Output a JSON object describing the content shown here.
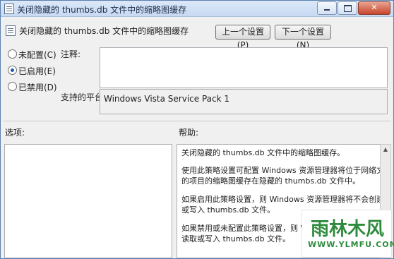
{
  "window": {
    "title": "关闭隐藏的 thumbs.db 文件中的缩略图缓存",
    "controls": {
      "minimize": "minimize-icon",
      "maximize": "maximize-icon",
      "close": "close-icon"
    }
  },
  "header": {
    "title": "关闭隐藏的 thumbs.db 文件中的缩略图缓存",
    "prev_label": "上一个设置(P)",
    "next_label": "下一个设置(N)"
  },
  "state": {
    "options": [
      {
        "label": "未配置(C)",
        "selected": false
      },
      {
        "label": "已启用(E)",
        "selected": true
      },
      {
        "label": "已禁用(D)",
        "selected": false
      }
    ]
  },
  "comment": {
    "label": "注释:",
    "value": ""
  },
  "platform": {
    "label": "支持的平台:",
    "value": "Windows Vista Service Pack 1"
  },
  "sections": {
    "options_label": "选项:",
    "help_label": "帮助:"
  },
  "help": {
    "p1": "关闭隐藏的 thumbs.db 文件中的缩略图缓存。",
    "p2a": "使用此策略设置可配置 Windows 资源管理器将位于网络文件夹中",
    "p2b": "的项目的缩略图缓存在隐藏的 thumbs.db 文件中。",
    "p3a": "如果启用此策略设置，则 Windows 资源管理器将不会创建、读取",
    "p3b": "或写入 thumbs.db 文件。",
    "p4a": "如果禁用或未配置此策略设置，则 Windo",
    "p4b": "读取或写入 thumbs.db 文件。"
  },
  "watermark": {
    "name": "雨林木风",
    "url": "WWW.YLMFU.COM"
  }
}
